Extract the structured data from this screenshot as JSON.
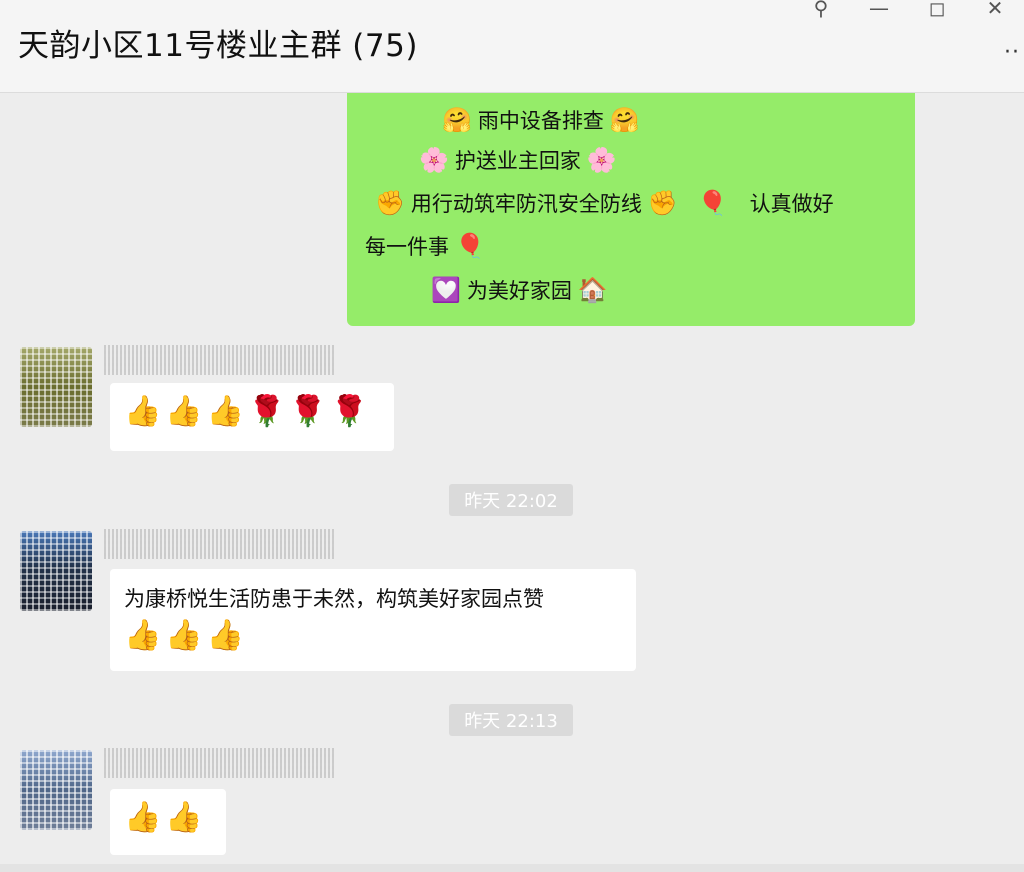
{
  "window": {
    "title": "天韵小区11号楼业主群 (75)",
    "controls": {
      "pin": "⚲",
      "minimize": "—",
      "maximize": "◻",
      "close": "✕"
    },
    "more": "··"
  },
  "messages": {
    "green": {
      "line1": {
        "icon": "🤗",
        "text": "雨中设备排查",
        "icon_end": "🤗"
      },
      "line2": {
        "icon": "🌸",
        "text": "护送业主回家",
        "icon_end": "🌸"
      },
      "line3": {
        "icon": "✊",
        "text": "用行动筑牢防汛安全防线",
        "icon_end": "✊",
        "balloon": "🎈",
        "text2": "认真做好"
      },
      "line4": {
        "text": "每一件事",
        "balloon": "🎈"
      },
      "line5": {
        "icon": "💟",
        "text": "为美好家园",
        "icon_end": "🏠"
      }
    },
    "msg1": {
      "content": "👍👍👍🌹🌹🌹"
    },
    "time1": "昨天 22:02",
    "msg2": {
      "text": "为康桥悦生活防患于未然，构筑美好家园点赞",
      "emoji": "👍👍👍"
    },
    "time2": "昨天 22:13",
    "msg3": {
      "content": "👍👍"
    }
  }
}
